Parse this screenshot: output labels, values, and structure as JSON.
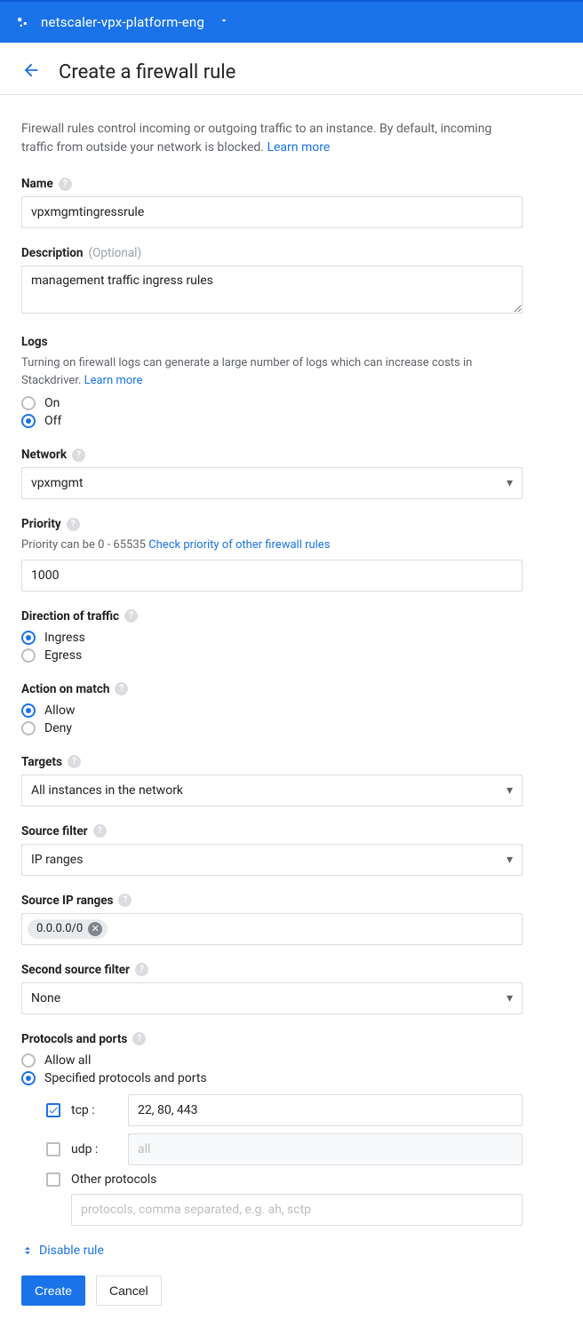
{
  "topbar": {
    "project": "netscaler-vpx-platform-eng"
  },
  "header": {
    "title": "Create a firewall rule"
  },
  "intro": {
    "text": "Firewall rules control incoming or outgoing traffic to an instance. By default, incoming traffic from outside your network is blocked. ",
    "learn_more": "Learn more"
  },
  "name": {
    "label": "Name",
    "value": "vpxmgmtingressrule"
  },
  "description": {
    "label": "Description",
    "optional": "(Optional)",
    "value": "management traffic ingress rules"
  },
  "logs": {
    "label": "Logs",
    "hint": "Turning on firewall logs can generate a large number of logs which can increase costs in Stackdriver. ",
    "learn_more": "Learn more",
    "on": "On",
    "off": "Off"
  },
  "network": {
    "label": "Network",
    "value": "vpxmgmt"
  },
  "priority": {
    "label": "Priority",
    "hint_prefix": "Priority can be 0 - 65535 ",
    "hint_link": "Check priority of other firewall rules",
    "value": "1000"
  },
  "direction": {
    "label": "Direction of traffic",
    "ingress": "Ingress",
    "egress": "Egress"
  },
  "action": {
    "label": "Action on match",
    "allow": "Allow",
    "deny": "Deny"
  },
  "targets": {
    "label": "Targets",
    "value": "All instances in the network"
  },
  "source_filter": {
    "label": "Source filter",
    "value": "IP ranges"
  },
  "source_ip": {
    "label": "Source IP ranges",
    "chip": "0.0.0.0/0"
  },
  "second_source": {
    "label": "Second source filter",
    "value": "None"
  },
  "protocols": {
    "label": "Protocols and ports",
    "allow_all": "Allow all",
    "specified": "Specified protocols and ports",
    "tcp_label": "tcp :",
    "tcp_value": "22, 80, 443",
    "udp_label": "udp :",
    "udp_placeholder": "all",
    "other_label": "Other protocols",
    "other_placeholder": "protocols, comma separated, e.g. ah, sctp"
  },
  "disable_rule": "Disable rule",
  "buttons": {
    "create": "Create",
    "cancel": "Cancel"
  }
}
